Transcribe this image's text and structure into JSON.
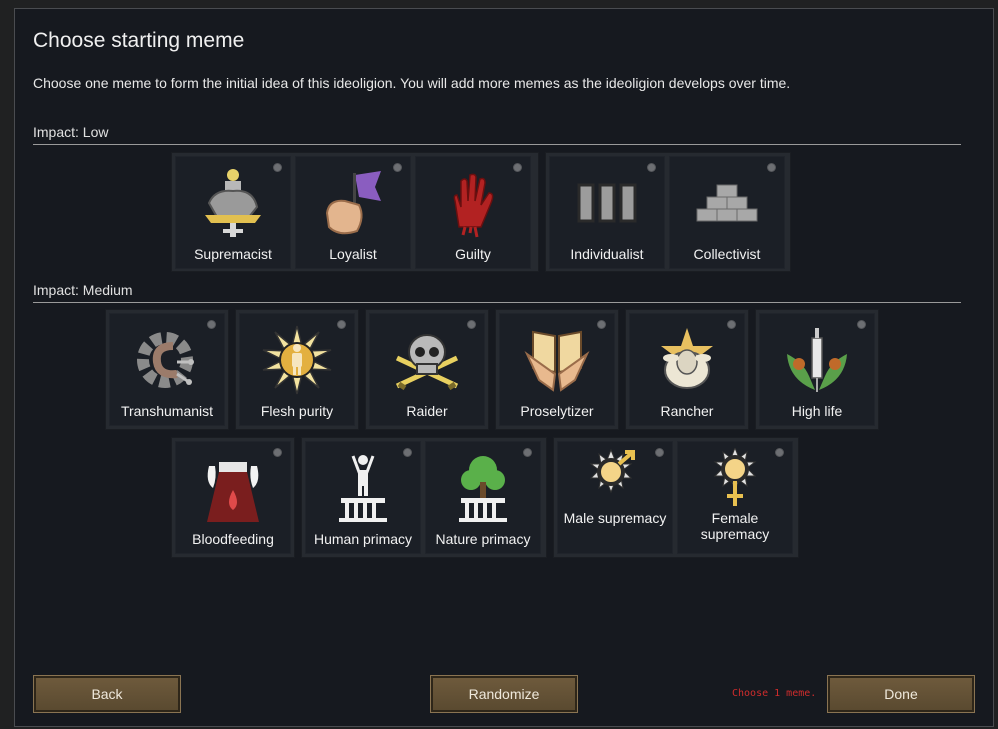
{
  "title": "Choose starting meme",
  "description": "Choose one meme to form the initial idea of this ideoligion. You will add more memes as the ideoligion develops over time.",
  "sections": {
    "low": {
      "label": "Impact: Low",
      "memes": [
        {
          "name": "Supremacist",
          "icon": "supremacist-icon"
        },
        {
          "name": "Loyalist",
          "icon": "loyalist-icon"
        },
        {
          "name": "Guilty",
          "icon": "guilty-icon"
        },
        {
          "name": "Individualist",
          "icon": "individualist-icon"
        },
        {
          "name": "Collectivist",
          "icon": "collectivist-icon"
        }
      ]
    },
    "medium": {
      "label": "Impact: Medium",
      "memes": [
        {
          "name": "Transhumanist",
          "icon": "transhumanist-icon"
        },
        {
          "name": "Flesh purity",
          "icon": "flesh-purity-icon"
        },
        {
          "name": "Raider",
          "icon": "raider-icon"
        },
        {
          "name": "Proselytizer",
          "icon": "proselytizer-icon"
        },
        {
          "name": "Rancher",
          "icon": "rancher-icon"
        },
        {
          "name": "High life",
          "icon": "high-life-icon"
        },
        {
          "name": "Bloodfeeding",
          "icon": "bloodfeeding-icon"
        },
        {
          "name": "Human primacy",
          "icon": "human-primacy-icon"
        },
        {
          "name": "Nature primacy",
          "icon": "nature-primacy-icon"
        },
        {
          "name": "Male supremacy",
          "icon": "male-supremacy-icon"
        },
        {
          "name": "Female supremacy",
          "icon": "female-supremacy-icon"
        }
      ]
    }
  },
  "buttons": {
    "back": "Back",
    "randomize": "Randomize",
    "done": "Done"
  },
  "status_hint": "Choose 1 meme.",
  "colors": {
    "button": "#6e5a3c",
    "hint": "#d02c2c",
    "panel": "#16191f"
  }
}
